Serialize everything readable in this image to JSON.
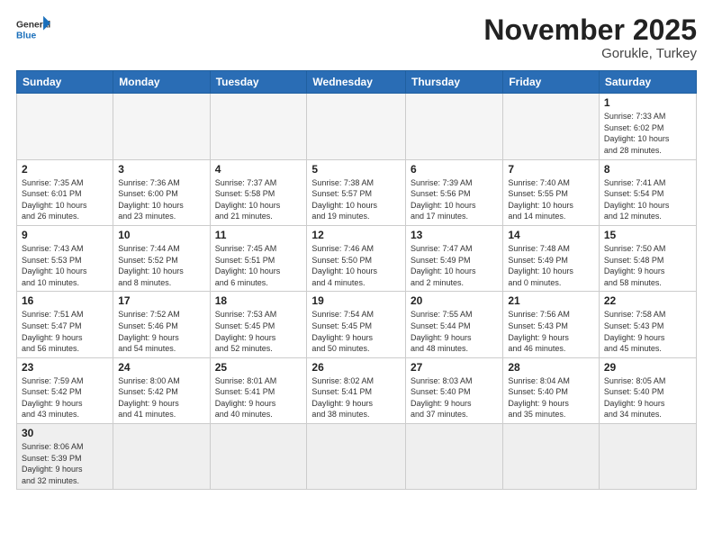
{
  "logo": {
    "general": "General",
    "blue": "Blue"
  },
  "header": {
    "month": "November 2025",
    "location": "Gorukle, Turkey"
  },
  "weekdays": [
    "Sunday",
    "Monday",
    "Tuesday",
    "Wednesday",
    "Thursday",
    "Friday",
    "Saturday"
  ],
  "weeks": [
    [
      {
        "day": "",
        "info": ""
      },
      {
        "day": "",
        "info": ""
      },
      {
        "day": "",
        "info": ""
      },
      {
        "day": "",
        "info": ""
      },
      {
        "day": "",
        "info": ""
      },
      {
        "day": "",
        "info": ""
      },
      {
        "day": "1",
        "info": "Sunrise: 7:33 AM\nSunset: 6:02 PM\nDaylight: 10 hours\nand 28 minutes."
      }
    ],
    [
      {
        "day": "2",
        "info": "Sunrise: 7:35 AM\nSunset: 6:01 PM\nDaylight: 10 hours\nand 26 minutes."
      },
      {
        "day": "3",
        "info": "Sunrise: 7:36 AM\nSunset: 6:00 PM\nDaylight: 10 hours\nand 23 minutes."
      },
      {
        "day": "4",
        "info": "Sunrise: 7:37 AM\nSunset: 5:58 PM\nDaylight: 10 hours\nand 21 minutes."
      },
      {
        "day": "5",
        "info": "Sunrise: 7:38 AM\nSunset: 5:57 PM\nDaylight: 10 hours\nand 19 minutes."
      },
      {
        "day": "6",
        "info": "Sunrise: 7:39 AM\nSunset: 5:56 PM\nDaylight: 10 hours\nand 17 minutes."
      },
      {
        "day": "7",
        "info": "Sunrise: 7:40 AM\nSunset: 5:55 PM\nDaylight: 10 hours\nand 14 minutes."
      },
      {
        "day": "8",
        "info": "Sunrise: 7:41 AM\nSunset: 5:54 PM\nDaylight: 10 hours\nand 12 minutes."
      }
    ],
    [
      {
        "day": "9",
        "info": "Sunrise: 7:43 AM\nSunset: 5:53 PM\nDaylight: 10 hours\nand 10 minutes."
      },
      {
        "day": "10",
        "info": "Sunrise: 7:44 AM\nSunset: 5:52 PM\nDaylight: 10 hours\nand 8 minutes."
      },
      {
        "day": "11",
        "info": "Sunrise: 7:45 AM\nSunset: 5:51 PM\nDaylight: 10 hours\nand 6 minutes."
      },
      {
        "day": "12",
        "info": "Sunrise: 7:46 AM\nSunset: 5:50 PM\nDaylight: 10 hours\nand 4 minutes."
      },
      {
        "day": "13",
        "info": "Sunrise: 7:47 AM\nSunset: 5:49 PM\nDaylight: 10 hours\nand 2 minutes."
      },
      {
        "day": "14",
        "info": "Sunrise: 7:48 AM\nSunset: 5:49 PM\nDaylight: 10 hours\nand 0 minutes."
      },
      {
        "day": "15",
        "info": "Sunrise: 7:50 AM\nSunset: 5:48 PM\nDaylight: 9 hours\nand 58 minutes."
      }
    ],
    [
      {
        "day": "16",
        "info": "Sunrise: 7:51 AM\nSunset: 5:47 PM\nDaylight: 9 hours\nand 56 minutes."
      },
      {
        "day": "17",
        "info": "Sunrise: 7:52 AM\nSunset: 5:46 PM\nDaylight: 9 hours\nand 54 minutes."
      },
      {
        "day": "18",
        "info": "Sunrise: 7:53 AM\nSunset: 5:45 PM\nDaylight: 9 hours\nand 52 minutes."
      },
      {
        "day": "19",
        "info": "Sunrise: 7:54 AM\nSunset: 5:45 PM\nDaylight: 9 hours\nand 50 minutes."
      },
      {
        "day": "20",
        "info": "Sunrise: 7:55 AM\nSunset: 5:44 PM\nDaylight: 9 hours\nand 48 minutes."
      },
      {
        "day": "21",
        "info": "Sunrise: 7:56 AM\nSunset: 5:43 PM\nDaylight: 9 hours\nand 46 minutes."
      },
      {
        "day": "22",
        "info": "Sunrise: 7:58 AM\nSunset: 5:43 PM\nDaylight: 9 hours\nand 45 minutes."
      }
    ],
    [
      {
        "day": "23",
        "info": "Sunrise: 7:59 AM\nSunset: 5:42 PM\nDaylight: 9 hours\nand 43 minutes."
      },
      {
        "day": "24",
        "info": "Sunrise: 8:00 AM\nSunset: 5:42 PM\nDaylight: 9 hours\nand 41 minutes."
      },
      {
        "day": "25",
        "info": "Sunrise: 8:01 AM\nSunset: 5:41 PM\nDaylight: 9 hours\nand 40 minutes."
      },
      {
        "day": "26",
        "info": "Sunrise: 8:02 AM\nSunset: 5:41 PM\nDaylight: 9 hours\nand 38 minutes."
      },
      {
        "day": "27",
        "info": "Sunrise: 8:03 AM\nSunset: 5:40 PM\nDaylight: 9 hours\nand 37 minutes."
      },
      {
        "day": "28",
        "info": "Sunrise: 8:04 AM\nSunset: 5:40 PM\nDaylight: 9 hours\nand 35 minutes."
      },
      {
        "day": "29",
        "info": "Sunrise: 8:05 AM\nSunset: 5:40 PM\nDaylight: 9 hours\nand 34 minutes."
      }
    ],
    [
      {
        "day": "30",
        "info": "Sunrise: 8:06 AM\nSunset: 5:39 PM\nDaylight: 9 hours\nand 32 minutes.",
        "last": true
      },
      {
        "day": "",
        "info": "",
        "last": true
      },
      {
        "day": "",
        "info": "",
        "last": true
      },
      {
        "day": "",
        "info": "",
        "last": true
      },
      {
        "day": "",
        "info": "",
        "last": true
      },
      {
        "day": "",
        "info": "",
        "last": true
      },
      {
        "day": "",
        "info": "",
        "last": true
      }
    ]
  ]
}
